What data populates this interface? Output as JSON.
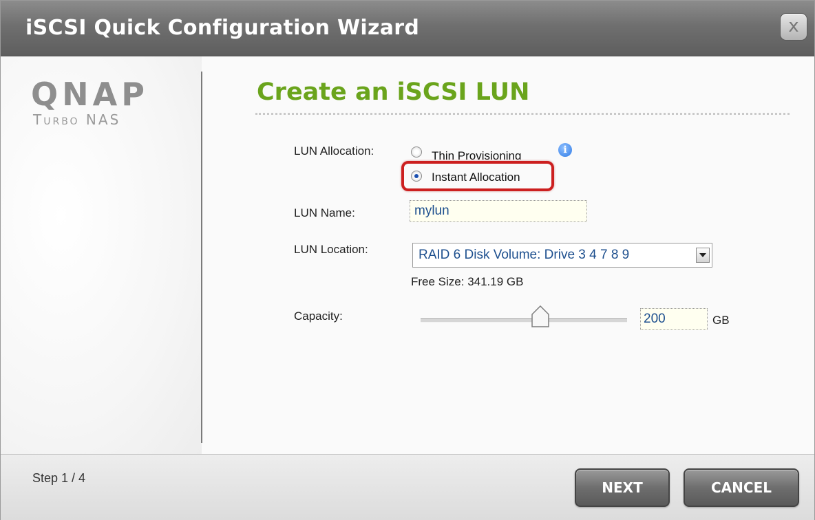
{
  "window": {
    "title": "iSCSI Quick Configuration Wizard",
    "close_label": "x"
  },
  "brand": {
    "logo": "QNAP",
    "subtitle": "Turbo NAS"
  },
  "page": {
    "heading": "Create an iSCSI LUN"
  },
  "form": {
    "allocation": {
      "label": "LUN Allocation:",
      "options": [
        {
          "label": "Thin Provisioning",
          "checked": false
        },
        {
          "label": "Instant Allocation",
          "checked": true
        }
      ],
      "info_icon": "info-icon"
    },
    "name": {
      "label": "LUN Name:",
      "value": "mylun"
    },
    "location": {
      "label": "LUN Location:",
      "selected": "RAID 6 Disk Volume: Drive 3 4 7 8 9",
      "free_size": "Free Size: 341.19 GB"
    },
    "capacity": {
      "label": "Capacity:",
      "value": "200",
      "unit": "GB",
      "slider_fraction": 0.58
    }
  },
  "footer": {
    "step": "Step 1 / 4",
    "next_label": "NEXT",
    "cancel_label": "CANCEL"
  },
  "colors": {
    "heading": "#6aa41c",
    "highlight": "#cc1f1f",
    "title_bar": "#707070"
  }
}
